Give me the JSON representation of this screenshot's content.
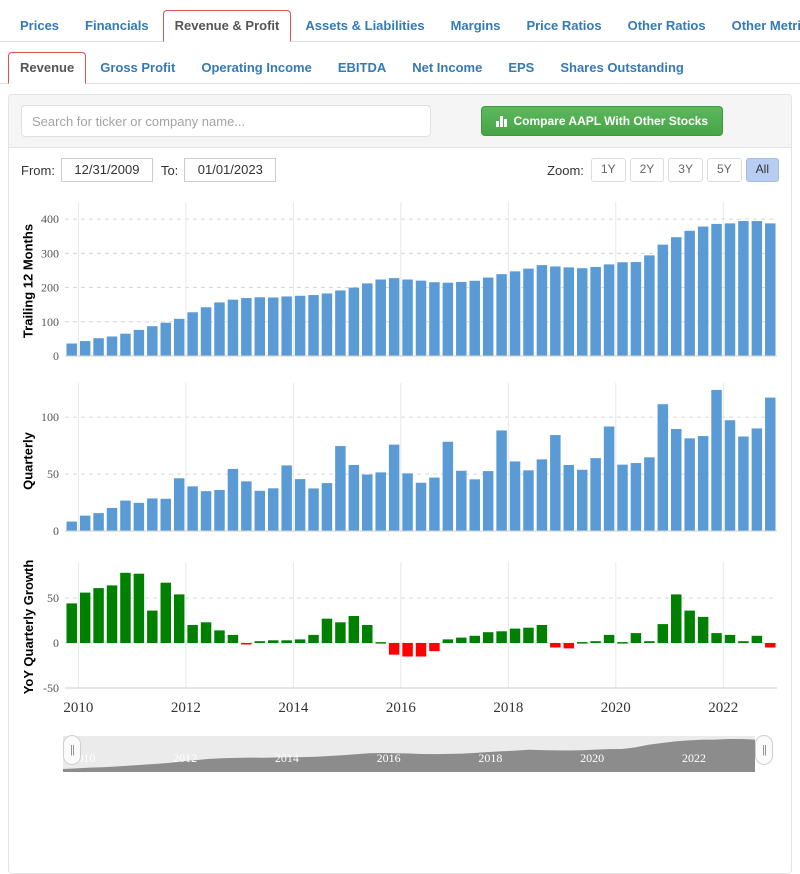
{
  "nav_primary": {
    "items": [
      {
        "label": "Prices",
        "active": false
      },
      {
        "label": "Financials",
        "active": false
      },
      {
        "label": "Revenue & Profit",
        "active": true
      },
      {
        "label": "Assets & Liabilities",
        "active": false
      },
      {
        "label": "Margins",
        "active": false
      },
      {
        "label": "Price Ratios",
        "active": false
      },
      {
        "label": "Other Ratios",
        "active": false
      },
      {
        "label": "Other Metrics",
        "active": false
      }
    ]
  },
  "nav_secondary": {
    "items": [
      {
        "label": "Revenue",
        "active": true
      },
      {
        "label": "Gross Profit",
        "active": false
      },
      {
        "label": "Operating Income",
        "active": false
      },
      {
        "label": "EBITDA",
        "active": false
      },
      {
        "label": "Net Income",
        "active": false
      },
      {
        "label": "EPS",
        "active": false
      },
      {
        "label": "Shares Outstanding",
        "active": false
      }
    ]
  },
  "search": {
    "placeholder": "Search for ticker or company name...",
    "value": ""
  },
  "compare_button": {
    "label": "Compare AAPL With Other Stocks",
    "icon": "bar-chart-icon",
    "color": "#5cb85c"
  },
  "controls": {
    "from_label": "From:",
    "from_value": "12/31/2009",
    "to_label": "To:",
    "to_value": "01/01/2023",
    "zoom_label": "Zoom:",
    "zoom_options": [
      {
        "label": "1Y",
        "active": false
      },
      {
        "label": "2Y",
        "active": false
      },
      {
        "label": "3Y",
        "active": false
      },
      {
        "label": "5Y",
        "active": false
      },
      {
        "label": "All",
        "active": true
      }
    ]
  },
  "colors": {
    "bar_blue": "#5b9bd5",
    "positive_green": "#008000",
    "negative_red": "#ff0000",
    "accent_link": "#337ab7",
    "active_tab_border": "#d9534f",
    "zoom_active_bg": "#b8cdf2"
  },
  "navigator": {
    "tick_labels": [
      "2010",
      "2012",
      "2014",
      "2016",
      "2018",
      "2020",
      "2022"
    ],
    "handle_icon": "drag-handle-icon"
  },
  "chart_data": [
    {
      "type": "bar",
      "title": "",
      "ylabel": "Trailing 12 Months",
      "xlabel": "",
      "ylim": [
        0,
        450
      ],
      "yticks": [
        0,
        100,
        200,
        300,
        400
      ],
      "grid": true,
      "bar_color": "#5b9bd5",
      "x": [
        "2009-12-31",
        "2010-03-31",
        "2010-06-30",
        "2010-09-30",
        "2010-12-31",
        "2011-03-31",
        "2011-06-30",
        "2011-09-30",
        "2011-12-31",
        "2012-03-31",
        "2012-06-30",
        "2012-09-30",
        "2012-12-31",
        "2013-03-31",
        "2013-06-30",
        "2013-09-30",
        "2013-12-31",
        "2014-03-31",
        "2014-06-30",
        "2014-09-30",
        "2014-12-31",
        "2015-03-31",
        "2015-06-30",
        "2015-09-30",
        "2015-12-31",
        "2016-03-31",
        "2016-06-30",
        "2016-09-30",
        "2016-12-31",
        "2017-03-31",
        "2017-06-30",
        "2017-09-30",
        "2017-12-31",
        "2018-03-31",
        "2018-06-30",
        "2018-09-30",
        "2018-12-31",
        "2019-03-31",
        "2019-06-30",
        "2019-09-30",
        "2019-12-31",
        "2020-03-31",
        "2020-06-30",
        "2020-09-30",
        "2020-12-31",
        "2021-03-31",
        "2021-06-30",
        "2021-09-30",
        "2021-12-31",
        "2022-03-31",
        "2022-06-30",
        "2022-09-30",
        "2022-12-31"
      ],
      "values": [
        36.5,
        43.6,
        51.9,
        57.0,
        65.2,
        76.3,
        87.1,
        97.2,
        108.6,
        127.8,
        142.4,
        156.5,
        164.7,
        169.4,
        171.6,
        170.9,
        173.99,
        176.0,
        178.1,
        182.8,
        191.5,
        199.9,
        212.2,
        223.5,
        227.5,
        223.5,
        220.3,
        215.6,
        214.2,
        216.2,
        219.8,
        229.2,
        239.2,
        247.4,
        255.3,
        265.6,
        261.6,
        259.0,
        256.6,
        260.2,
        267.7,
        273.9,
        274.5,
        294.1,
        325.4,
        347.2,
        365.8,
        378.3,
        386.0,
        387.5,
        394.3,
        394.3,
        387.5
      ],
      "value_unit": "$ billions"
    },
    {
      "type": "bar",
      "title": "",
      "ylabel": "Quarterly",
      "xlabel": "",
      "ylim": [
        0,
        130
      ],
      "yticks": [
        0,
        50,
        100
      ],
      "grid": true,
      "bar_color": "#5b9bd5",
      "x": [
        "2009-12-31",
        "2010-03-31",
        "2010-06-30",
        "2010-09-30",
        "2010-12-31",
        "2011-03-31",
        "2011-06-30",
        "2011-09-30",
        "2011-12-31",
        "2012-03-31",
        "2012-06-30",
        "2012-09-30",
        "2012-12-31",
        "2013-03-31",
        "2013-06-30",
        "2013-09-30",
        "2013-12-31",
        "2014-03-31",
        "2014-06-30",
        "2014-09-30",
        "2014-12-31",
        "2015-03-31",
        "2015-06-30",
        "2015-09-30",
        "2015-12-31",
        "2016-03-31",
        "2016-06-30",
        "2016-09-30",
        "2016-12-31",
        "2017-03-31",
        "2017-06-30",
        "2017-09-30",
        "2017-12-31",
        "2018-03-31",
        "2018-06-30",
        "2018-09-30",
        "2018-12-31",
        "2019-03-31",
        "2019-06-30",
        "2019-09-30",
        "2019-12-31",
        "2020-03-31",
        "2020-06-30",
        "2020-09-30",
        "2020-12-31",
        "2021-03-31",
        "2021-06-30",
        "2021-09-30",
        "2021-12-31",
        "2022-03-31",
        "2022-06-30",
        "2022-09-30",
        "2022-12-31"
      ],
      "values": [
        8.3,
        13.5,
        15.7,
        20.3,
        26.7,
        24.7,
        28.6,
        28.3,
        46.3,
        39.2,
        35.0,
        36.0,
        54.5,
        43.6,
        35.3,
        37.5,
        57.6,
        45.6,
        37.4,
        42.1,
        74.6,
        58.0,
        49.6,
        51.5,
        75.9,
        50.6,
        42.4,
        46.9,
        78.4,
        52.9,
        45.4,
        52.6,
        88.3,
        61.1,
        53.3,
        62.9,
        84.3,
        58.0,
        53.8,
        64.0,
        91.8,
        58.3,
        59.7,
        64.7,
        111.4,
        89.6,
        81.4,
        83.4,
        123.9,
        97.3,
        83.0,
        90.1,
        117.2
      ],
      "value_unit": "$ billions"
    },
    {
      "type": "bar",
      "title": "",
      "ylabel": "YoY Quarterly Growth",
      "xlabel": "",
      "ylim": [
        -50,
        90
      ],
      "yticks": [
        -50,
        0,
        50
      ],
      "grid": true,
      "positive_color": "#008000",
      "negative_color": "#ff0000",
      "xticks": [
        "2010",
        "2012",
        "2014",
        "2016",
        "2018",
        "2020",
        "2022"
      ],
      "x": [
        "2009-12-31",
        "2010-03-31",
        "2010-06-30",
        "2010-09-30",
        "2010-12-31",
        "2011-03-31",
        "2011-06-30",
        "2011-09-30",
        "2011-12-31",
        "2012-03-31",
        "2012-06-30",
        "2012-09-30",
        "2012-12-31",
        "2013-03-31",
        "2013-06-30",
        "2013-09-30",
        "2013-12-31",
        "2014-03-31",
        "2014-06-30",
        "2014-09-30",
        "2014-12-31",
        "2015-03-31",
        "2015-06-30",
        "2015-09-30",
        "2015-12-31",
        "2016-03-31",
        "2016-06-30",
        "2016-09-30",
        "2016-12-31",
        "2017-03-31",
        "2017-06-30",
        "2017-09-30",
        "2017-12-31",
        "2018-03-31",
        "2018-06-30",
        "2018-09-30",
        "2018-12-31",
        "2019-03-31",
        "2019-06-30",
        "2019-09-30",
        "2019-12-31",
        "2020-03-31",
        "2020-06-30",
        "2020-09-30",
        "2020-12-31",
        "2021-03-31",
        "2021-06-30",
        "2021-09-30",
        "2021-12-31",
        "2022-03-31",
        "2022-06-30",
        "2022-09-30",
        "2022-12-31"
      ],
      "values": [
        44,
        56,
        61,
        64,
        78,
        77,
        36,
        67,
        54,
        20,
        23,
        14,
        9,
        -1,
        2,
        3,
        3,
        4,
        9,
        27,
        23,
        30,
        20,
        1,
        -13,
        -15,
        -15,
        -9,
        4,
        6,
        8,
        12,
        13,
        16,
        17,
        20,
        -5,
        -6,
        1,
        2,
        9,
        1,
        11,
        2,
        21,
        54,
        36,
        29,
        11,
        9,
        2,
        8,
        -5
      ],
      "value_unit": "percent"
    }
  ]
}
